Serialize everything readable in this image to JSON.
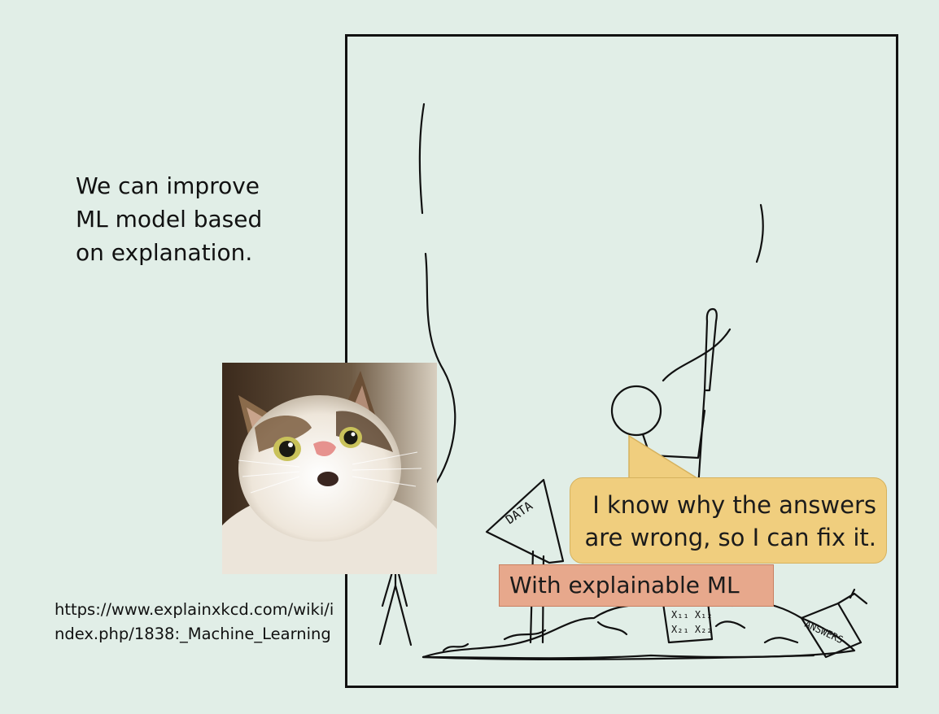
{
  "slide": {
    "main_text": "We can improve\nML model based\non explanation.",
    "source_url": "https://www.explainxkcd.com/wiki/index.php/1838:_Machine_Learning"
  },
  "comic": {
    "sign_data": "DATA",
    "sign_answers": "ANSWERS",
    "pile_labels": [
      "X₁₁ X₁₂",
      "X₂₁ X₂₂"
    ]
  },
  "speech_bubble": {
    "text": "I know why the answers\nare wrong, so I can fix it."
  },
  "label": {
    "text": "With explainable ML"
  },
  "colors": {
    "background": "#e1eee7",
    "bubble_fill": "#f0ce7e",
    "label_fill": "#e7a88c",
    "cat_fur": "#f2ece3"
  }
}
